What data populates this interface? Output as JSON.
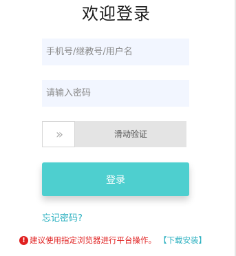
{
  "page": {
    "title": "欢迎登录"
  },
  "form": {
    "username_placeholder": "手机号/继教号/用户名",
    "password_placeholder": "请输入密码",
    "slider_handle_symbol": "»",
    "slider_label": "滑动验证",
    "login_label": "登录",
    "forgot_label": "忘记密码?"
  },
  "notice": {
    "icon_symbol": "!",
    "text": "建议使用指定浏览器进行平台操作。",
    "download_label": "【下载安装】"
  },
  "colors": {
    "accent": "#4ecfcf",
    "link": "#2bb0c0",
    "warning": "#e02020",
    "input_bg": "#f2f6ff"
  }
}
